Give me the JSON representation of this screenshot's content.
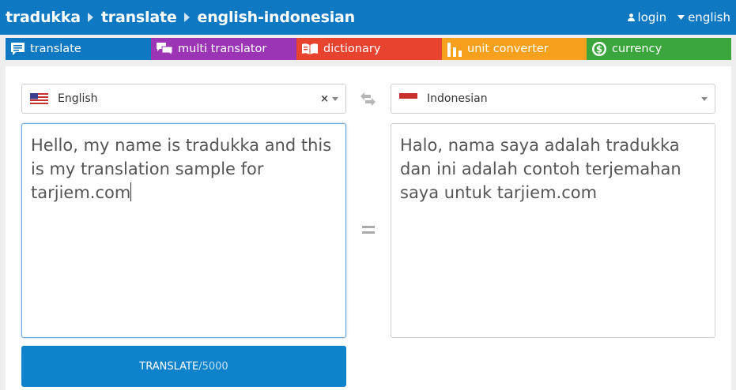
{
  "breadcrumb": {
    "items": [
      "tradukka",
      "translate",
      "english-indonesian"
    ]
  },
  "header": {
    "login_label": "login",
    "language_label": "english"
  },
  "tabs": [
    {
      "label": "translate",
      "color": "#0f78c2",
      "icon": "chat-bubble-icon"
    },
    {
      "label": "multi translator",
      "color": "#9b34b5",
      "icon": "multi-chat-icon"
    },
    {
      "label": "dictionary",
      "color": "#e8432f",
      "icon": "open-book-icon"
    },
    {
      "label": "unit converter",
      "color": "#f7a01d",
      "icon": "bar-chart-icon"
    },
    {
      "label": "currency",
      "color": "#3aa63c",
      "icon": "dollar-coin-icon"
    }
  ],
  "source": {
    "language": "English",
    "flag": "us-flag-icon",
    "text": "Hello, my name is tradukka and this is my translation sample for tarjiem.com"
  },
  "target": {
    "language": "Indonesian",
    "flag": "indonesia-flag-icon",
    "text": "Halo, nama saya adalah tradukka dan ini adalah contoh terjemahan saya untuk tarjiem.com"
  },
  "translate_button": {
    "label": "TRANSLATE",
    "separator": " / ",
    "count": "5000"
  }
}
